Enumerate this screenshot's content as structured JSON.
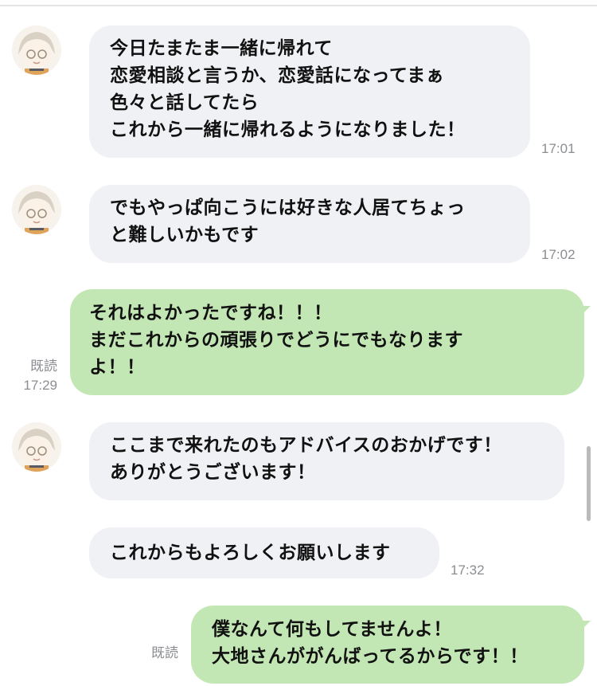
{
  "messages": [
    {
      "side": "received",
      "lines": [
        "今日たまたま一緒に帰れて",
        "恋愛相談と言うか、恋愛話になってまぁ",
        "色々と話してたら",
        "これから一緒に帰れるようになりました！"
      ],
      "time": "17:01"
    },
    {
      "side": "received",
      "lines": [
        "でもやっぱ向こうには好きな人居てちょっ",
        "と難しいかもです"
      ],
      "time": "17:02"
    },
    {
      "side": "sent",
      "lines": [
        "それはよかったですね！！！",
        "まだこれからの頑張りでどうにでもなります",
        "よ！！"
      ],
      "read": "既読",
      "time": "17:29"
    },
    {
      "side": "received",
      "lines": [
        "ここまで来れたのもアドバイスのおかげです！",
        "ありがとうございます！"
      ]
    },
    {
      "side": "received",
      "lines": [
        "これからもよろしくお願いします"
      ],
      "time": "17:32"
    },
    {
      "side": "sent",
      "lines": [
        "僕なんて何もしてませんよ！",
        "大地さんががんばってるからです！！"
      ],
      "read": "既読"
    }
  ],
  "colors": {
    "received_bubble": "#f0f1f4",
    "sent_bubble": "#c3e7b4",
    "meta_text": "#8b8d92"
  },
  "icons": {
    "avatar": "anime-character-avatar"
  }
}
